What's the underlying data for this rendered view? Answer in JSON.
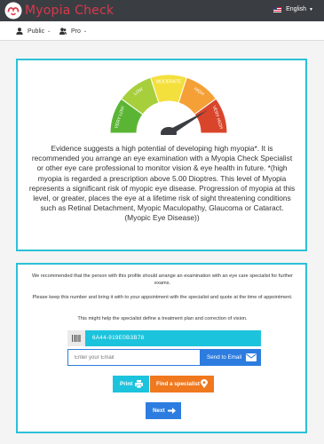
{
  "brand": {
    "name": "Myopia Check",
    "logo_icon": "eye-logo-icon",
    "color": "#d9394a"
  },
  "header": {
    "language": "English",
    "flag_icon": "us-flag-icon"
  },
  "subnav": [
    {
      "label": "Public",
      "icon": "user-icon"
    },
    {
      "label": "Pro",
      "icon": "users-icon"
    }
  ],
  "gauge": {
    "labels": [
      "VERY LOW",
      "LOW",
      "MODERATE",
      "HIGH",
      "VERY HIGH"
    ],
    "colors": [
      "#5bb535",
      "#a7cf3c",
      "#f4e03d",
      "#f5a036",
      "#d9452b"
    ],
    "level_fraction": 0.83
  },
  "result": {
    "text": "Evidence suggests a high potential of developing high myopia*. It is recommended you arrange an eye examination with a Myopia Check Specialist or other eye care professional to monitor vision & eye health in future. *(high myopia is regarded a prescription above 5.00 Dioptres. This level of Myopia represents a significant risk of myopic eye disease. Progression of myopia at this level, or greater, places the eye at a lifetime risk of sight threatening conditions such as Retinal Detachment, Myopic Maculopathy, Glaucoma or Cataract. (Myopic Eye Disease))"
  },
  "recommend": {
    "p1": "We recommended that the person with this profile should arrange an examination with an eye care specialist for further exams.",
    "p2": "Please keep this number and bring it with to your appointment with the specialist and quote at the time of appointment.",
    "p3": "This might help the specialist define a treatment plan and correction of vision.",
    "code": "6A44-919E0B3B78",
    "code_icon": "barcode-icon",
    "email_placeholder": "Enter your Email",
    "email_value": "",
    "send_label": "Send to Email",
    "send_icon": "envelope-icon",
    "print_label": "Print",
    "print_icon": "printer-icon",
    "specialist_label": "Find a specialist",
    "specialist_icon": "map-marker-icon",
    "next_label": "Next",
    "next_icon": "arrow-right-icon"
  }
}
